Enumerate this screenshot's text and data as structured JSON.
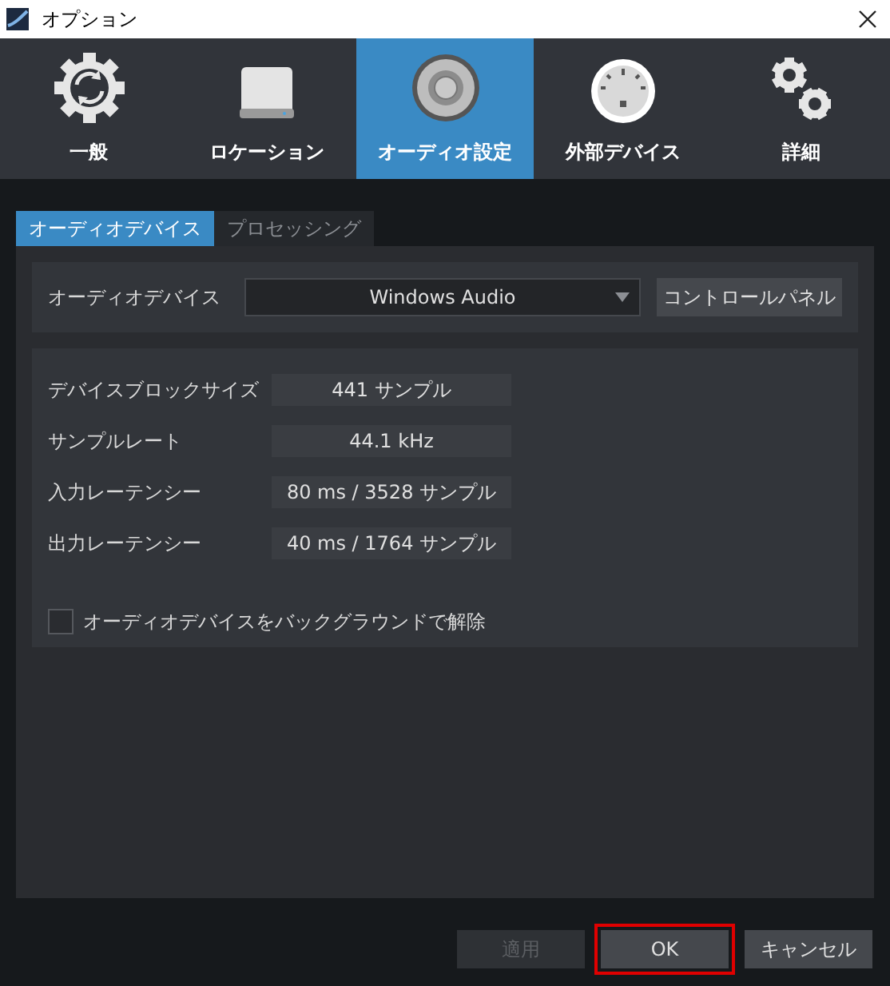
{
  "window": {
    "title": "オプション"
  },
  "categories": [
    {
      "label": "一般",
      "kind": "gear",
      "selected": false
    },
    {
      "label": "ロケーション",
      "kind": "drive",
      "selected": false
    },
    {
      "label": "オーディオ設定",
      "kind": "speaker",
      "selected": true
    },
    {
      "label": "外部デバイス",
      "kind": "dial",
      "selected": false
    },
    {
      "label": "詳細",
      "kind": "gears",
      "selected": false
    }
  ],
  "tabs": [
    {
      "label": "オーディオデバイス",
      "selected": true
    },
    {
      "label": "プロセッシング",
      "selected": false
    }
  ],
  "device": {
    "label": "オーディオデバイス",
    "value": "Windows Audio",
    "button": "コントロールパネル"
  },
  "info": [
    {
      "label": "デバイスブロックサイズ",
      "value": "441 サンプル"
    },
    {
      "label": "サンプルレート",
      "value": "44.1 kHz"
    },
    {
      "label": "入力レーテンシー",
      "value": "80 ms / 3528 サンプル"
    },
    {
      "label": "出力レーテンシー",
      "value": "40 ms / 1764 サンプル"
    }
  ],
  "release_option": {
    "label": "オーディオデバイスをバックグラウンドで解除",
    "checked": false
  },
  "buttons": [
    {
      "label": "適用",
      "disabled": true,
      "highlighted": false
    },
    {
      "label": "OK",
      "disabled": false,
      "highlighted": true
    },
    {
      "label": "キャンセル",
      "disabled": false,
      "highlighted": false
    }
  ]
}
